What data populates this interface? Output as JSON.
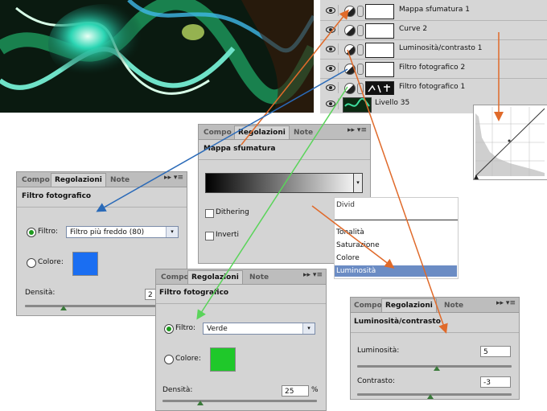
{
  "layers": [
    {
      "name": "Mappa sfumatura 1",
      "mask": "white"
    },
    {
      "name": "Curve 2",
      "mask": "white"
    },
    {
      "name": "Luminosità/contrasto 1",
      "mask": "white"
    },
    {
      "name": "Filtro fotografico 2",
      "mask": "white"
    },
    {
      "name": "Filtro fotografico 1",
      "mask": "black"
    },
    {
      "name": "Livello 35",
      "mask": "thumb"
    }
  ],
  "tabs": {
    "compo": "Compo",
    "regolazioni": "Regolazioni",
    "note": "Note",
    "controls": "▸▸ ▾≡"
  },
  "gradient_panel": {
    "title": "Mappa sfumatura",
    "dithering": "Dithering",
    "inverti": "Inverti",
    "dither_label_truncated": "Divid"
  },
  "filtro1_panel": {
    "title": "Filtro fotografico",
    "filtro_label": "Filtro:",
    "filtro_value": "Filtro più freddo (80)",
    "colore_label": "Colore:",
    "color": "#1a6ef2",
    "densita_label": "Densità:",
    "densita_value": "2"
  },
  "filtro2_panel": {
    "title": "Filtro fotografico",
    "filtro_label": "Filtro:",
    "filtro_value": "Verde",
    "colore_label": "Colore:",
    "color": "#1fc82a",
    "densita_label": "Densità:",
    "densita_value": "25",
    "percent": "%"
  },
  "lum_panel": {
    "title": "Luminosità/contrasto",
    "lum_label": "Luminosità:",
    "lum_value": "5",
    "contrast_label": "Contrasto:",
    "contrast_value": "-3"
  },
  "dropdown": {
    "items": [
      "Tonalità",
      "Saturazione",
      "Colore",
      "Luminosità"
    ],
    "selected": "Luminosità"
  },
  "arrow_colors": {
    "orange": "#e06a2a",
    "blue": "#2a6ab8",
    "green": "#5ad45a"
  }
}
